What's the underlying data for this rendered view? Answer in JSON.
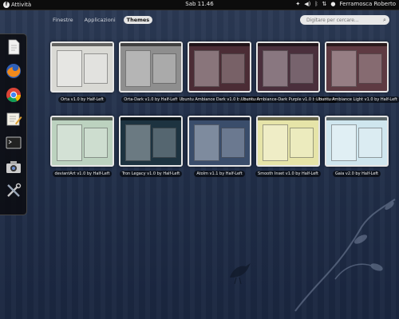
{
  "topbar": {
    "activities_label": "Attività",
    "clock": "Sab 11.46",
    "user_name": "Ferramosca Roberto"
  },
  "tabs": [
    {
      "label": "Finestre",
      "active": false
    },
    {
      "label": "Applicazioni",
      "active": false
    },
    {
      "label": "Themes",
      "active": true
    }
  ],
  "search": {
    "placeholder": "Digitare per cercare..."
  },
  "dash": {
    "items": [
      {
        "icon": "file-icon"
      },
      {
        "icon": "firefox-icon"
      },
      {
        "icon": "chrome-icon"
      },
      {
        "icon": "text-editor-icon"
      },
      {
        "icon": "terminal-icon"
      },
      {
        "icon": "camera-icon"
      },
      {
        "icon": "tools-icon"
      }
    ]
  },
  "themes": [
    {
      "label": "Orta v1.0 by Half-Left",
      "color": "#d9d9d4"
    },
    {
      "label": "Orta-Dark v1.0 by Half-Left",
      "color": "#8e8e8e"
    },
    {
      "label": "Ubuntu Ambiance Dark v1.0 by Half-Left",
      "color": "#4b2c35"
    },
    {
      "label": "Ubuntu Ambiance-Dark Purple v1.0 by Half-Left",
      "color": "#4a2f3c"
    },
    {
      "label": "Ubuntu Ambiance Light v1.0 by Half-Left",
      "color": "#5e3a42"
    },
    {
      "label": "deviantArt v1.0 by Half-Left",
      "color": "#bcd2bf"
    },
    {
      "label": "Tron Legacy v1.0 by Half-Left",
      "color": "#1d3340"
    },
    {
      "label": "Atolm v1.1 by Half-Left",
      "color": "#3a4d6b"
    },
    {
      "label": "Smooth Inset v1.0 by Half-Left",
      "color": "#e6e4a8"
    },
    {
      "label": "Gaia v2.0 by Half-Left",
      "color": "#cfe6ee"
    }
  ]
}
